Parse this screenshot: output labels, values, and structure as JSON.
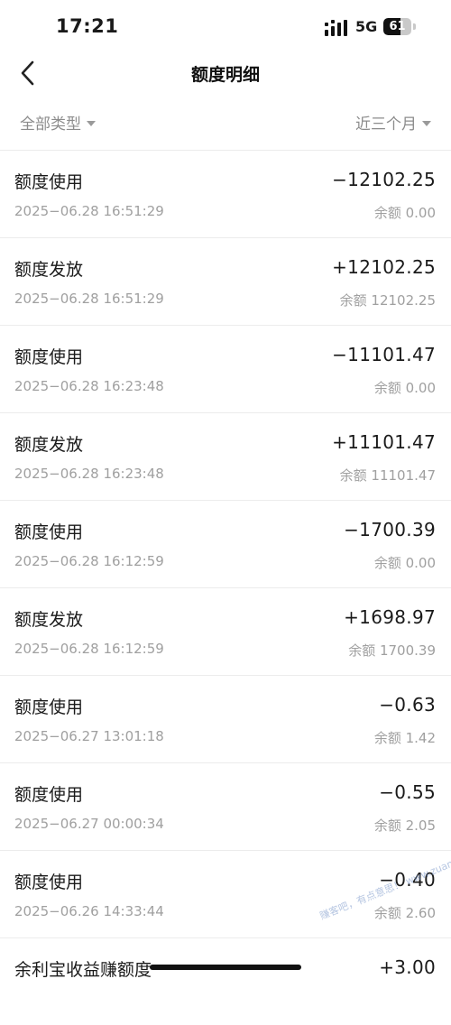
{
  "status_bar": {
    "time": "17:21",
    "network": "5G",
    "battery": "61",
    "battery_level": 0.61,
    "signal_icon": "signal-bars-icon"
  },
  "nav": {
    "back_icon": "chevron-left-icon",
    "title": "额度明细"
  },
  "filters": {
    "type": "全部类型",
    "period": "近三个月"
  },
  "records": [
    {
      "type": "额度使用",
      "amount": "−12102.25",
      "time": "2025−06.28 16:51:29",
      "balance": "余额 0.00"
    },
    {
      "type": "额度发放",
      "amount": "+12102.25",
      "time": "2025−06.28 16:51:29",
      "balance": "余额 12102.25"
    },
    {
      "type": "额度使用",
      "amount": "−11101.47",
      "time": "2025−06.28 16:23:48",
      "balance": "余额 0.00"
    },
    {
      "type": "额度发放",
      "amount": "+11101.47",
      "time": "2025−06.28 16:23:48",
      "balance": "余额 11101.47"
    },
    {
      "type": "额度使用",
      "amount": "−1700.39",
      "time": "2025−06.28 16:12:59",
      "balance": "余额 0.00"
    },
    {
      "type": "额度发放",
      "amount": "+1698.97",
      "time": "2025−06.28 16:12:59",
      "balance": "余额 1700.39"
    },
    {
      "type": "额度使用",
      "amount": "−0.63",
      "time": "2025−06.27 13:01:18",
      "balance": "余额 1.42"
    },
    {
      "type": "额度使用",
      "amount": "−0.55",
      "time": "2025−06.27 00:00:34",
      "balance": "余额 2.05"
    },
    {
      "type": "额度使用",
      "amount": "−0.40",
      "time": "2025−06.26 14:33:44",
      "balance": "余额 2.60"
    },
    {
      "type": "余利宝收益赚额度",
      "amount": "+3.00",
      "time": "",
      "balance": ""
    }
  ],
  "watermark": "赚客吧，有点意思！ www.zuanke8.com"
}
